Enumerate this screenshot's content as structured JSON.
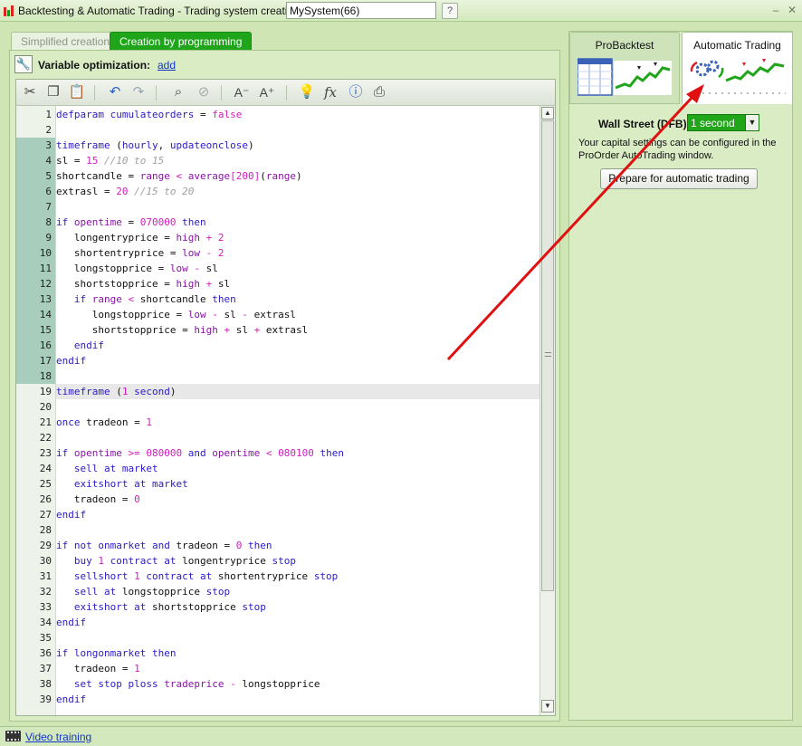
{
  "window": {
    "title": "Backtesting & Automatic Trading - Trading system creation  -",
    "system_name": "MySystem(66)",
    "controls": [
      "minimize-icon",
      "maximize-icon",
      "close-icon"
    ]
  },
  "tabs": {
    "simplified": "Simplified creation",
    "programming": "Creation by programming"
  },
  "variable_optimization": {
    "label": "Variable optimization:",
    "add_link": "add"
  },
  "toolbar_icons": [
    "cut-icon",
    "copy-icon",
    "paste-icon",
    "undo-icon",
    "redo-icon",
    "search-icon",
    "comment-icon",
    "decrease-font-icon",
    "increase-font-icon",
    "idea-icon",
    "function-icon",
    "help-icon",
    "print-icon"
  ],
  "code_lines": [
    [
      [
        "kw",
        "defparam"
      ],
      [
        "id",
        " "
      ],
      [
        "kw",
        "cumulateorders"
      ],
      [
        "id",
        " = "
      ],
      [
        "num-lit",
        "false"
      ]
    ],
    [],
    [
      [
        "kw",
        "timeframe"
      ],
      [
        "id",
        " ("
      ],
      [
        "kw",
        "hourly"
      ],
      [
        "id",
        ", "
      ],
      [
        "kw",
        "updateonclose"
      ],
      [
        "id",
        ")"
      ]
    ],
    [
      [
        "id",
        "sl = "
      ],
      [
        "num-lit",
        "15"
      ],
      [
        "id",
        " "
      ],
      [
        "cm",
        "//10 to 15"
      ]
    ],
    [
      [
        "id",
        "shortcandle = "
      ],
      [
        "fn",
        "range"
      ],
      [
        "id",
        " "
      ],
      [
        "op",
        "<"
      ],
      [
        "id",
        " "
      ],
      [
        "fn",
        "average"
      ],
      [
        "op",
        "["
      ],
      [
        "num-lit",
        "200"
      ],
      [
        "op",
        "]"
      ],
      [
        "id",
        "("
      ],
      [
        "fn",
        "range"
      ],
      [
        "id",
        ")"
      ]
    ],
    [
      [
        "id",
        "extrasl = "
      ],
      [
        "num-lit",
        "20"
      ],
      [
        "id",
        " "
      ],
      [
        "cm",
        "//15 to 20"
      ]
    ],
    [],
    [
      [
        "kw",
        "if"
      ],
      [
        "id",
        " "
      ],
      [
        "fn",
        "opentime"
      ],
      [
        "id",
        " = "
      ],
      [
        "num-lit",
        "070000"
      ],
      [
        "id",
        " "
      ],
      [
        "kw",
        "then"
      ]
    ],
    [
      [
        "id",
        "   longentryprice = "
      ],
      [
        "fn",
        "high"
      ],
      [
        "id",
        " "
      ],
      [
        "op",
        "+"
      ],
      [
        "id",
        " "
      ],
      [
        "num-lit",
        "2"
      ]
    ],
    [
      [
        "id",
        "   shortentryprice = "
      ],
      [
        "fn",
        "low"
      ],
      [
        "id",
        " "
      ],
      [
        "op",
        "-"
      ],
      [
        "id",
        " "
      ],
      [
        "num-lit",
        "2"
      ]
    ],
    [
      [
        "id",
        "   longstopprice = "
      ],
      [
        "fn",
        "low"
      ],
      [
        "id",
        " "
      ],
      [
        "op",
        "-"
      ],
      [
        "id",
        " sl"
      ]
    ],
    [
      [
        "id",
        "   shortstopprice = "
      ],
      [
        "fn",
        "high"
      ],
      [
        "id",
        " "
      ],
      [
        "op",
        "+"
      ],
      [
        "id",
        " sl"
      ]
    ],
    [
      [
        "id",
        "   "
      ],
      [
        "kw",
        "if"
      ],
      [
        "id",
        " "
      ],
      [
        "fn",
        "range"
      ],
      [
        "id",
        " "
      ],
      [
        "op",
        "<"
      ],
      [
        "id",
        " shortcandle "
      ],
      [
        "kw",
        "then"
      ]
    ],
    [
      [
        "id",
        "      longstopprice = "
      ],
      [
        "fn",
        "low"
      ],
      [
        "id",
        " "
      ],
      [
        "op",
        "-"
      ],
      [
        "id",
        " sl "
      ],
      [
        "op",
        "-"
      ],
      [
        "id",
        " extrasl"
      ]
    ],
    [
      [
        "id",
        "      shortstopprice = "
      ],
      [
        "fn",
        "high"
      ],
      [
        "id",
        " "
      ],
      [
        "op",
        "+"
      ],
      [
        "id",
        " sl "
      ],
      [
        "op",
        "+"
      ],
      [
        "id",
        " extrasl"
      ]
    ],
    [
      [
        "id",
        "   "
      ],
      [
        "kw",
        "endif"
      ]
    ],
    [
      [
        "kw",
        "endif"
      ]
    ],
    [],
    [
      [
        "kw",
        "timeframe"
      ],
      [
        "id",
        " ("
      ],
      [
        "num-lit",
        "1"
      ],
      [
        "id",
        " "
      ],
      [
        "kw",
        "second"
      ],
      [
        "id",
        ")"
      ]
    ],
    [],
    [
      [
        "kw",
        "once"
      ],
      [
        "id",
        " tradeon = "
      ],
      [
        "num-lit",
        "1"
      ]
    ],
    [],
    [
      [
        "kw",
        "if"
      ],
      [
        "id",
        " "
      ],
      [
        "fn",
        "opentime"
      ],
      [
        "id",
        " "
      ],
      [
        "op",
        ">="
      ],
      [
        "id",
        " "
      ],
      [
        "num-lit",
        "080000"
      ],
      [
        "id",
        " "
      ],
      [
        "kw",
        "and"
      ],
      [
        "id",
        " "
      ],
      [
        "fn",
        "opentime"
      ],
      [
        "id",
        " "
      ],
      [
        "op",
        "<"
      ],
      [
        "id",
        " "
      ],
      [
        "num-lit",
        "080100"
      ],
      [
        "id",
        " "
      ],
      [
        "kw",
        "then"
      ]
    ],
    [
      [
        "id",
        "   "
      ],
      [
        "kw",
        "sell"
      ],
      [
        "id",
        " "
      ],
      [
        "kw",
        "at"
      ],
      [
        "id",
        " "
      ],
      [
        "kw",
        "market"
      ]
    ],
    [
      [
        "id",
        "   "
      ],
      [
        "kw",
        "exitshort"
      ],
      [
        "id",
        " "
      ],
      [
        "kw",
        "at"
      ],
      [
        "id",
        " "
      ],
      [
        "kw",
        "market"
      ]
    ],
    [
      [
        "id",
        "   tradeon = "
      ],
      [
        "num-lit",
        "0"
      ]
    ],
    [
      [
        "kw",
        "endif"
      ]
    ],
    [],
    [
      [
        "kw",
        "if"
      ],
      [
        "id",
        " "
      ],
      [
        "kw",
        "not"
      ],
      [
        "id",
        " "
      ],
      [
        "kw",
        "onmarket"
      ],
      [
        "id",
        " "
      ],
      [
        "kw",
        "and"
      ],
      [
        "id",
        " tradeon = "
      ],
      [
        "num-lit",
        "0"
      ],
      [
        "id",
        " "
      ],
      [
        "kw",
        "then"
      ]
    ],
    [
      [
        "id",
        "   "
      ],
      [
        "kw",
        "buy"
      ],
      [
        "id",
        " "
      ],
      [
        "num-lit",
        "1"
      ],
      [
        "id",
        " "
      ],
      [
        "kw",
        "contract"
      ],
      [
        "id",
        " "
      ],
      [
        "kw",
        "at"
      ],
      [
        "id",
        " longentryprice "
      ],
      [
        "kw",
        "stop"
      ]
    ],
    [
      [
        "id",
        "   "
      ],
      [
        "kw",
        "sellshort"
      ],
      [
        "id",
        " "
      ],
      [
        "num-lit",
        "1"
      ],
      [
        "id",
        " "
      ],
      [
        "kw",
        "contract"
      ],
      [
        "id",
        " "
      ],
      [
        "kw",
        "at"
      ],
      [
        "id",
        " shortentryprice "
      ],
      [
        "kw",
        "stop"
      ]
    ],
    [
      [
        "id",
        "   "
      ],
      [
        "kw",
        "sell"
      ],
      [
        "id",
        " "
      ],
      [
        "kw",
        "at"
      ],
      [
        "id",
        " longstopprice "
      ],
      [
        "kw",
        "stop"
      ]
    ],
    [
      [
        "id",
        "   "
      ],
      [
        "kw",
        "exitshort"
      ],
      [
        "id",
        " "
      ],
      [
        "kw",
        "at"
      ],
      [
        "id",
        " shortstopprice "
      ],
      [
        "kw",
        "stop"
      ]
    ],
    [
      [
        "kw",
        "endif"
      ]
    ],
    [],
    [
      [
        "kw",
        "if"
      ],
      [
        "id",
        " "
      ],
      [
        "kw",
        "longonmarket"
      ],
      [
        "id",
        " "
      ],
      [
        "kw",
        "then"
      ]
    ],
    [
      [
        "id",
        "   tradeon = "
      ],
      [
        "num-lit",
        "1"
      ]
    ],
    [
      [
        "id",
        "   "
      ],
      [
        "kw",
        "set"
      ],
      [
        "id",
        " "
      ],
      [
        "kw",
        "stop"
      ],
      [
        "id",
        " "
      ],
      [
        "kw",
        "ploss"
      ],
      [
        "id",
        " "
      ],
      [
        "fn",
        "tradeprice"
      ],
      [
        "id",
        " "
      ],
      [
        "op",
        "-"
      ],
      [
        "id",
        " longstopprice"
      ]
    ],
    [
      [
        "kw",
        "endif"
      ]
    ]
  ],
  "highlighted_lines": [
    3,
    4,
    5,
    6,
    7,
    8,
    9,
    10,
    11,
    12,
    13,
    14,
    15,
    16,
    17,
    18
  ],
  "current_line": 19,
  "right_panel": {
    "tab_backtest": "ProBacktest",
    "tab_automatic": "Automatic Trading",
    "market_label": "Wall Street (DFB)",
    "timeframe_value": "1 second",
    "capital_note": "Your capital settings can be configured in the ProOrder AutoTrading window.",
    "prepare_button": "Prepare for automatic trading"
  },
  "status": {
    "video_link": "Video training"
  },
  "colors": {
    "accent_green": "#1fa51a",
    "panel_bg": "#d9ecc4",
    "annotation_arrow": "#e01010"
  }
}
